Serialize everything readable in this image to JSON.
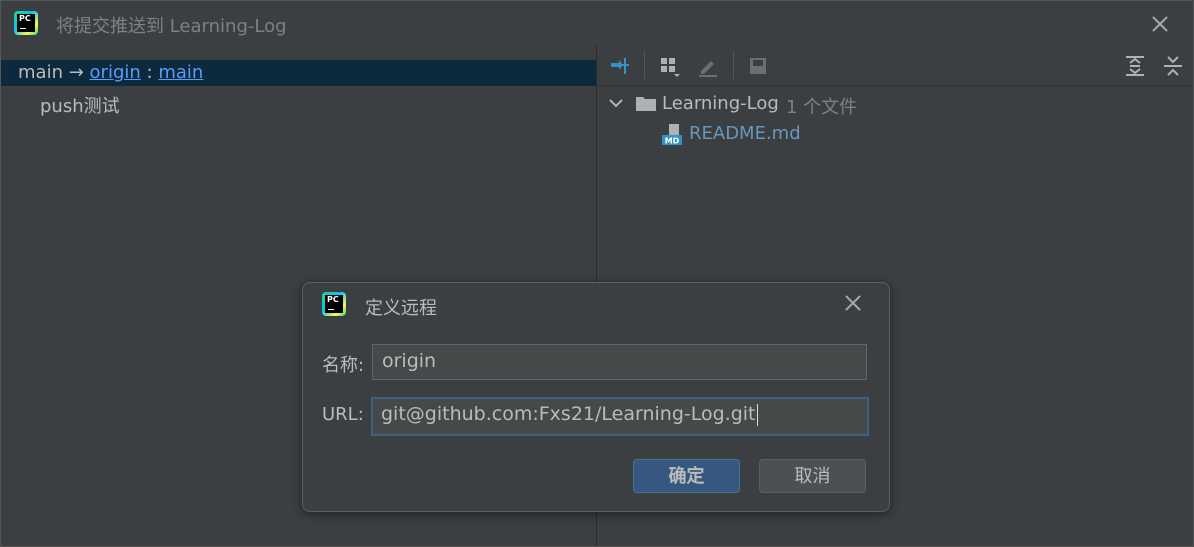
{
  "window": {
    "title": "将提交推送到 Learning-Log"
  },
  "push_branch": {
    "local": "main",
    "arrow": "→",
    "remote": "origin",
    "separator": ":",
    "remote_branch": "main"
  },
  "commits": [
    {
      "message": "push测试"
    }
  ],
  "changes_tree": {
    "root_label": "Learning-Log",
    "root_count": "1 个文件",
    "files": [
      {
        "name": "README.md",
        "type_badge": "MD"
      }
    ]
  },
  "toolbar_icons": [
    "expand-arrows-icon",
    "group-by-icon",
    "edit-icon",
    "save-icon",
    "expand-all-icon",
    "collapse-all-icon"
  ],
  "dialog": {
    "title": "定义远程",
    "name_label": "名称:",
    "name_value": "origin",
    "url_label": "URL:",
    "url_value": "git@github.com:Fxs21/Learning-Log.git",
    "ok_label": "确定",
    "cancel_label": "取消"
  },
  "colors": {
    "background": "#3c3f41",
    "selection": "#0d293e",
    "link": "#589df6",
    "primary_button": "#365880",
    "focus_border": "#3d6185"
  }
}
